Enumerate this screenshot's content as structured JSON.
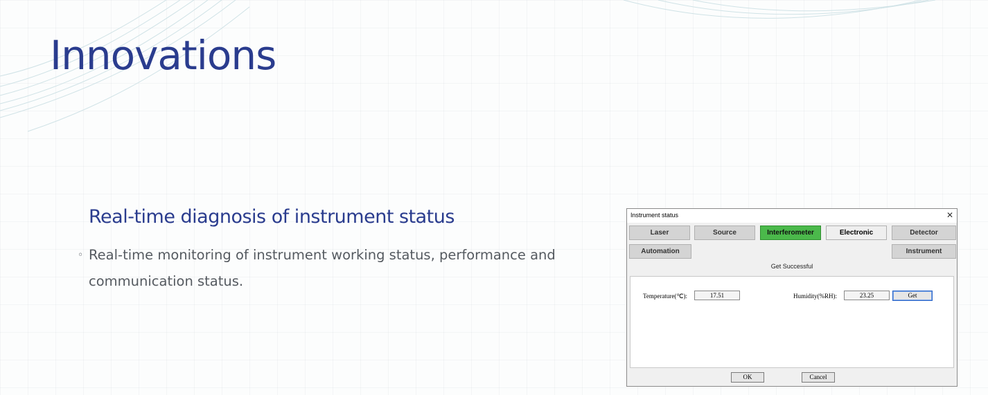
{
  "slide": {
    "title": "Innovations",
    "subtitle": "Real-time diagnosis of instrument status",
    "bullet_symbol": "◦",
    "bullet_text": "Real-time monitoring of instrument working status, performance and communication status."
  },
  "dialog": {
    "title": "Instrument status",
    "close_symbol": "✕",
    "tabs_row1": [
      {
        "label": "Laser",
        "active": false
      },
      {
        "label": "Source",
        "active": false
      },
      {
        "label": "Interferometer",
        "active": true
      },
      {
        "label": "Electronic",
        "active": false
      },
      {
        "label": "Detector",
        "active": false
      }
    ],
    "tabs_row2": [
      {
        "label": "Automation"
      },
      {
        "label": "Instrument"
      }
    ],
    "status": "Get Successful",
    "temperature_label": "Temperature(℃):",
    "temperature_value": "17.51",
    "humidity_label": "Humidity(%RH):",
    "humidity_value": "23.25",
    "get_label": "Get",
    "ok_label": "OK",
    "cancel_label": "Cancel"
  },
  "colors": {
    "title_blue": "#2a3c8e",
    "active_tab_green": "#4bb94b"
  }
}
